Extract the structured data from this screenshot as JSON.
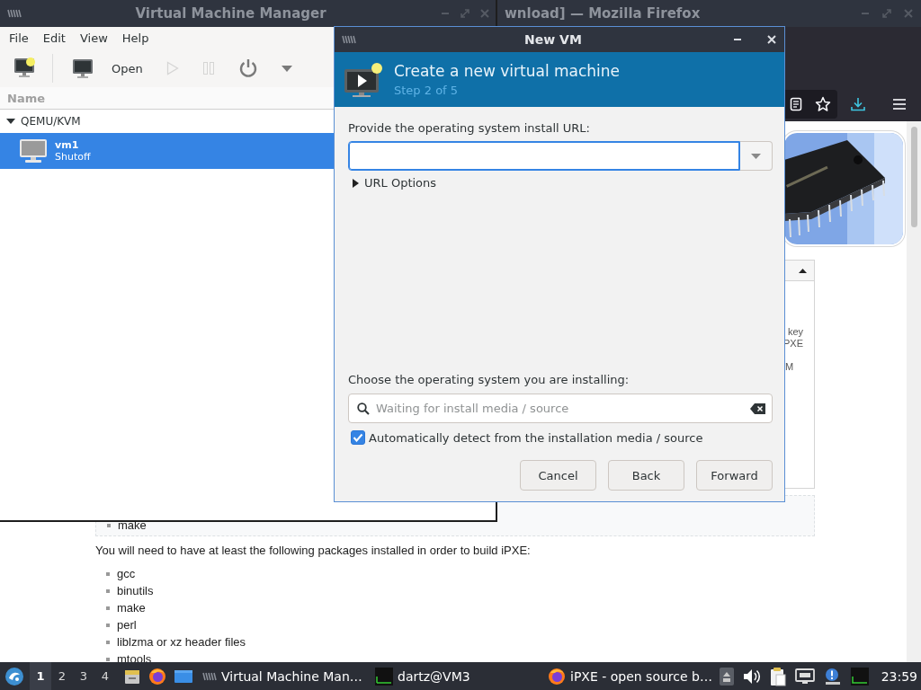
{
  "firefox": {
    "title": "wnload] — Mozilla Firefox",
    "page": {
      "side_fragments": [
        "key",
        "PXE",
        "M"
      ],
      "boxed_item": "make",
      "paragraph": "You will need to have at least the following packages installed in order to build iPXE:",
      "packages": [
        "gcc",
        "binutils",
        "make",
        "perl",
        "liblzma or xz header files",
        "mtools"
      ]
    }
  },
  "vmm": {
    "title": "Virtual Machine Manager",
    "menu": [
      "File",
      "Edit",
      "View",
      "Help"
    ],
    "toolbar": [
      {
        "kind": "new",
        "disabled": false
      },
      {
        "kind": "open",
        "label": "Open",
        "disabled": false
      },
      {
        "kind": "run",
        "disabled": true
      },
      {
        "kind": "pause",
        "disabled": true
      },
      {
        "kind": "shutdown",
        "disabled": false
      },
      {
        "kind": "menu",
        "disabled": false
      }
    ],
    "column": "Name",
    "connections": [
      {
        "name": "QEMU/KVM",
        "expanded": true,
        "children": [
          {
            "name": "vm1",
            "status": "Shutoff",
            "selected": true
          }
        ]
      }
    ]
  },
  "dialog": {
    "title": "New VM",
    "heading": "Create a new virtual machine",
    "step": "Step 2 of 5",
    "url_label": "Provide the operating system install URL:",
    "url_options": {
      "label": "URL Options",
      "expanded": false
    },
    "os_label": "Choose the operating system you are installing:",
    "os_search": {
      "placeholder": "Waiting for install media / source"
    },
    "auto_detect": {
      "label": "Automatically detect from the installation media / source",
      "checked": true
    },
    "buttons": [
      "Cancel",
      "Back",
      "Forward"
    ]
  },
  "taskbar": {
    "workspaces": [
      {
        "label": "1",
        "selected": true
      },
      {
        "label": "2",
        "selected": false
      },
      {
        "label": "3",
        "selected": false
      },
      {
        "label": "4",
        "selected": false
      }
    ],
    "tasks": [
      {
        "kind": "vmm",
        "label": "Virtual Machine Man…"
      },
      {
        "kind": "terminal",
        "label": "dartz@VM3"
      },
      {
        "kind": "firefox",
        "label": "iPXE - open source b…"
      }
    ],
    "clock": "23:59"
  }
}
